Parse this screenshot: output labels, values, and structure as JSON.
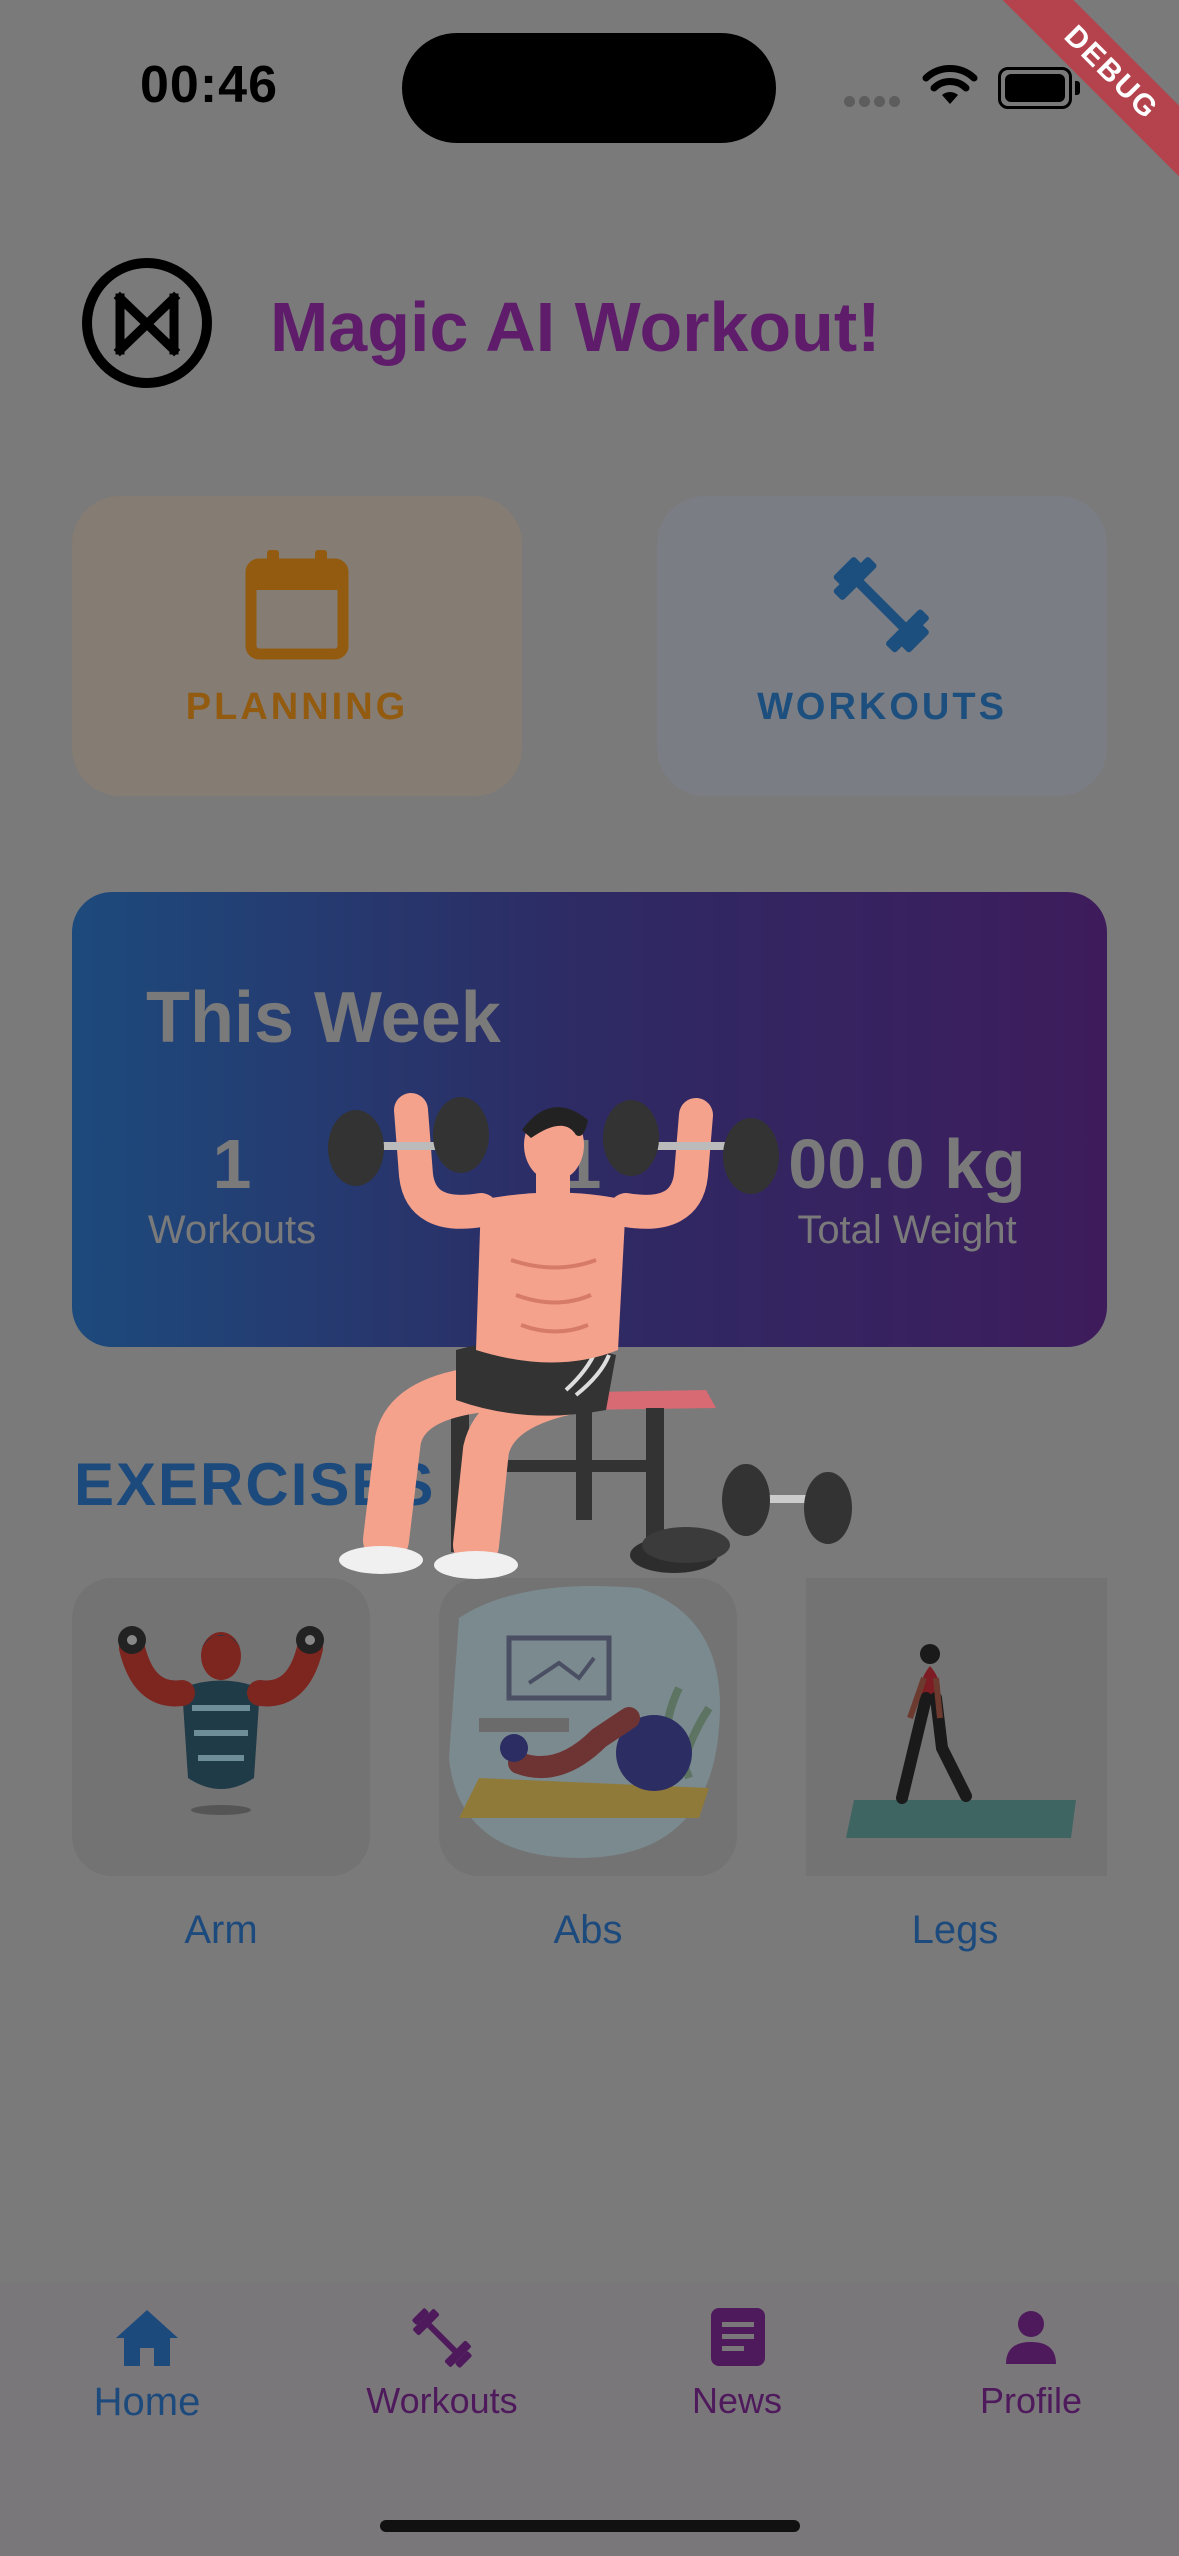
{
  "status_bar": {
    "time": "00:46",
    "debug_banner": "DEBUG"
  },
  "header": {
    "title": "Magic AI Workout!",
    "logo_icon": "magic-logo-icon"
  },
  "quick_actions": [
    {
      "label": "PLANNING",
      "icon": "calendar-icon",
      "color": "#925b10"
    },
    {
      "label": "WORKOUTS",
      "icon": "dumbbell-icon",
      "color": "#1c4f7e"
    }
  ],
  "this_week": {
    "title": "This Week",
    "stats": [
      {
        "value": "1",
        "label": "Workouts"
      },
      {
        "value": "1",
        "label": ""
      },
      {
        "value": "00.0 kg",
        "label": "Total Weight"
      }
    ]
  },
  "exercises": {
    "title": "EXERCISES",
    "items": [
      {
        "label": "Arm",
        "icon": "arm-exercise-illustration"
      },
      {
        "label": "Abs",
        "icon": "abs-exercise-illustration"
      },
      {
        "label": "Legs",
        "icon": "legs-exercise-illustration"
      }
    ]
  },
  "loading_overlay": {
    "icon": "bench-press-man-illustration"
  },
  "bottom_nav": [
    {
      "label": "Home",
      "icon": "home-icon",
      "active": true
    },
    {
      "label": "Workouts",
      "icon": "dumbbell-icon",
      "active": false
    },
    {
      "label": "News",
      "icon": "news-icon",
      "active": false
    },
    {
      "label": "Profile",
      "icon": "person-icon",
      "active": false
    }
  ],
  "colors": {
    "background": "#7a7a7a",
    "title": "#5e1c6b",
    "accent_blue": "#1d4a7c",
    "accent_purple": "#4e1a5c",
    "planning_orange": "#925b10"
  }
}
